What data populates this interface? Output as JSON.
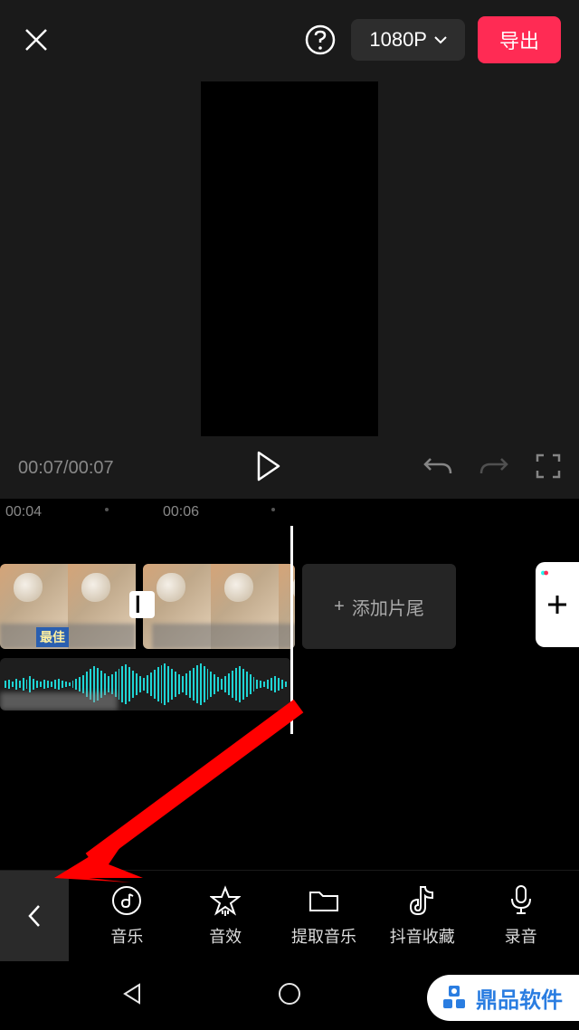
{
  "header": {
    "resolution": "1080P",
    "export_label": "导出"
  },
  "playbar": {
    "timecode": "00:07/00:07"
  },
  "ruler": {
    "ticks": [
      "00:04",
      "00:06"
    ]
  },
  "timeline": {
    "clip1_caption": "最佳",
    "add_ending_label": "添加片尾",
    "transition_glyph": "▎"
  },
  "toolbar": {
    "items": [
      {
        "label": "音乐",
        "icon": "music-note-icon"
      },
      {
        "label": "音效",
        "icon": "star-sound-icon"
      },
      {
        "label": "提取音乐",
        "icon": "folder-icon"
      },
      {
        "label": "抖音收藏",
        "icon": "douyin-icon"
      },
      {
        "label": "录音",
        "icon": "microphone-icon"
      }
    ]
  },
  "watermark": {
    "text": "鼎品软件"
  }
}
